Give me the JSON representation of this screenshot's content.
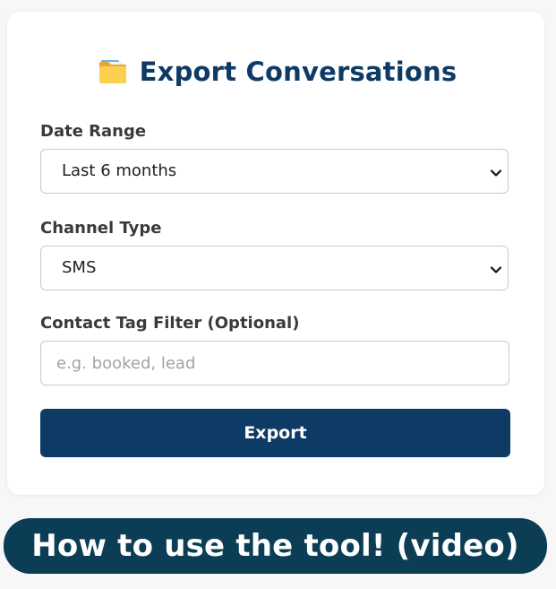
{
  "form": {
    "title": "Export Conversations",
    "title_icon": "folder-icon",
    "date_range": {
      "label": "Date Range",
      "selected": "Last 6 months"
    },
    "channel_type": {
      "label": "Channel Type",
      "selected": "SMS"
    },
    "tag_filter": {
      "label": "Contact Tag Filter (Optional)",
      "value": "",
      "placeholder": "e.g. booked, lead"
    },
    "export_button_label": "Export"
  },
  "video_link": {
    "label": "How to use the tool! (video)"
  },
  "colors": {
    "accent": "#0e3a66",
    "banner": "#0b3d55",
    "card_background": "#ffffff",
    "page_background": "#f7f7f8"
  }
}
